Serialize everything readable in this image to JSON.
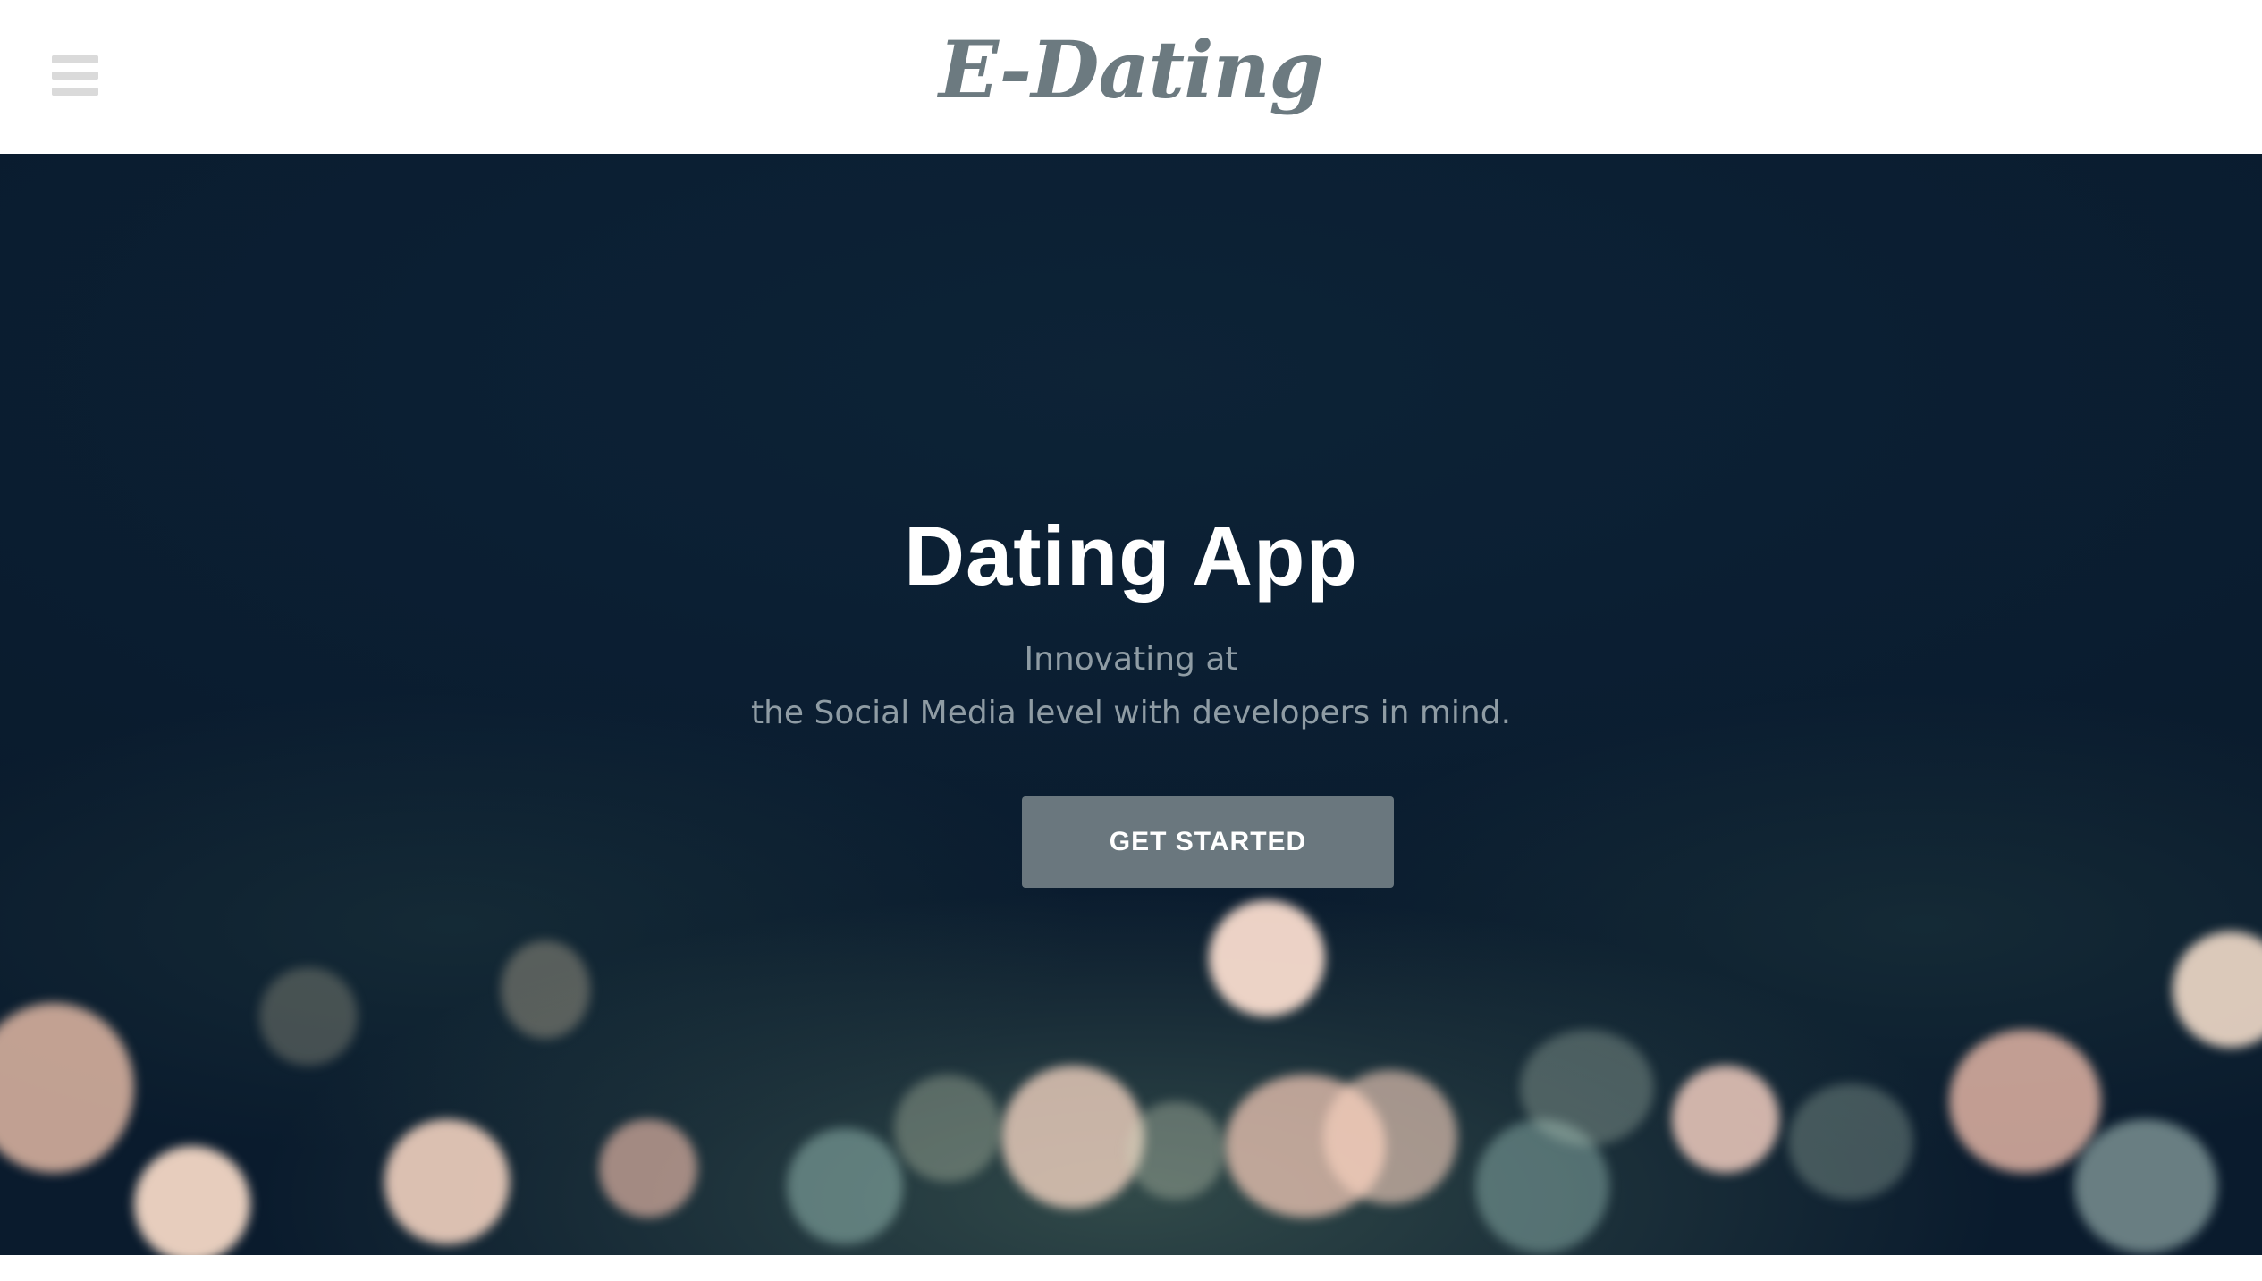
{
  "header": {
    "brand": "E-Dating",
    "menu_icon": "hamburger-menu-icon"
  },
  "hero": {
    "title": "Dating App",
    "subtitle_line1": "Innovating at",
    "subtitle_line2": "the Social Media level with developers in mind.",
    "cta_label": "GET STARTED"
  },
  "colors": {
    "brand_text": "#6c7a80",
    "hero_background": "#0b1f33",
    "cta_background": "#6a777e",
    "cta_text": "#ffffff",
    "menu_icon": "#dadada"
  }
}
